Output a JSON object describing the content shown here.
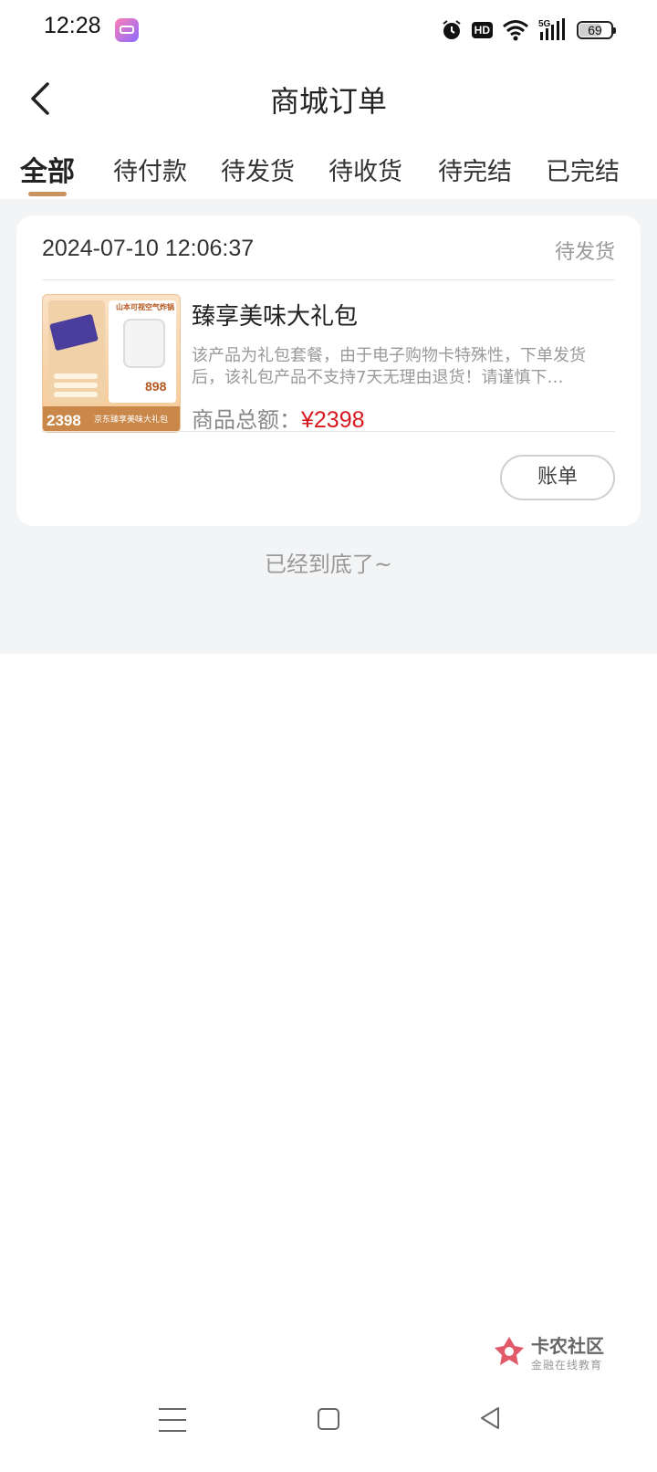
{
  "status_bar": {
    "time": "12:28",
    "hd_label": "HD",
    "network": "5G",
    "battery": "69",
    "battery_level": 0.69
  },
  "header": {
    "title": "商城订单",
    "back_icon": "chevron-left-icon"
  },
  "tabs": [
    {
      "label": "全部",
      "active": true
    },
    {
      "label": "待付款",
      "active": false
    },
    {
      "label": "待发货",
      "active": false
    },
    {
      "label": "待收货",
      "active": false
    },
    {
      "label": "待完结",
      "active": false
    },
    {
      "label": "已完结",
      "active": false
    }
  ],
  "orders": [
    {
      "datetime": "2024-07-10 12:06:37",
      "status": "待发货",
      "thumbnail": {
        "price": "2398",
        "banner": "京东臻享美味大礼包",
        "ad_title": "山本可视空气炸锅",
        "ad_price": "898"
      },
      "product_name": "臻享美味大礼包",
      "description": "该产品为礼包套餐，由于电子购物卡特殊性，下单发货后，该礼包产品不支持7天无理由退货！请谨慎下单，…",
      "amount_label": "商品总额：",
      "amount_value": "¥2398",
      "bill_button": "账单"
    }
  ],
  "end_of_list": "已经到底了~",
  "watermark": {
    "title": "卡农社区",
    "subtitle": "金融在线教育"
  },
  "colors": {
    "accent": "#c9925e",
    "price_red": "#d8191f",
    "background_gray": "#f3f4f5"
  }
}
